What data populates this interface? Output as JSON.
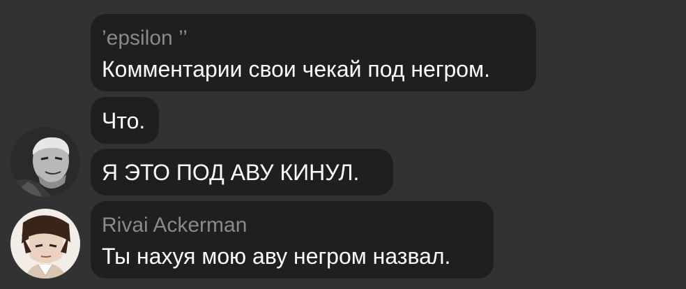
{
  "messages": [
    {
      "sender": "’epsilon ’’",
      "text": "Комментарии свои чекай под негром."
    },
    {
      "sender": "",
      "text": "Что."
    },
    {
      "sender": "",
      "text": "Я ЭТО ПОД АВУ КИНУЛ."
    },
    {
      "sender": "Rivai Ackerman",
      "text": "Ты нахуя мою аву негром назвал."
    }
  ],
  "avatars": [
    {
      "icon": "grayscale-man-avatar-icon"
    },
    {
      "icon": "anime-character-avatar-icon"
    }
  ],
  "colors": {
    "background": "#323234",
    "bubble": "#1f1f21",
    "sender_name": "#8a8a8e",
    "text": "#ffffff"
  }
}
